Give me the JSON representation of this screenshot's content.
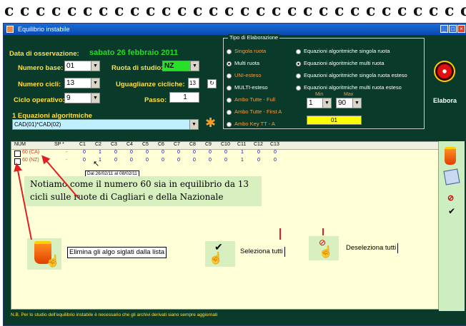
{
  "window": {
    "title": "Equilibrio instabile"
  },
  "labels": {
    "data_osservazione": "Data di osservazione:",
    "data_value": "sabato 26 febbraio 2011",
    "numero_base": "Numero base:",
    "numero_cicli": "Numero cicli:",
    "ciclo_operativo": "Ciclo operativo:",
    "ruota_studio": "Ruota di studio:",
    "uguaglianze": "Uguaglianze cicliche:",
    "passo": "Passo:",
    "equazioni": "1 Equazioni algoritmiche",
    "tipo_elaborazione": "Tipo di Elaborazione",
    "min": "Min",
    "max": "Max",
    "elabora": "Elabora"
  },
  "fields": {
    "numero_base": "01",
    "numero_cicli": "13",
    "ciclo_operativo": "9",
    "ruota": "NZ",
    "uguaglianze": "13",
    "passo": "1",
    "equazione": "CAD(01)*CAD(02)",
    "min": "1",
    "max": "90",
    "yellow_value": "01"
  },
  "radios": [
    {
      "label": "Singola ruota",
      "orange": true,
      "on": false
    },
    {
      "label": "Multi ruota",
      "orange": false,
      "on": true
    },
    {
      "label": "UNI-esteso",
      "orange": true,
      "on": false
    },
    {
      "label": "MULTI-esteso",
      "orange": false,
      "on": false
    },
    {
      "label": "Ambo Tutte - Full",
      "orange": true,
      "on": false
    },
    {
      "label": "Ambo Tutte - First A",
      "orange": true,
      "on": false
    },
    {
      "label": "Ambo Key TT - A",
      "orange": true,
      "on": false
    }
  ],
  "radios_right": [
    {
      "label": "Equazioni algoritmiche singola ruota"
    },
    {
      "label": "Equazioni algoritmiche multi ruota"
    },
    {
      "label": "Equazioni algoritmiche singola ruota esteso"
    },
    {
      "label": "Equazioni algoritmiche multi ruota esteso"
    }
  ],
  "table": {
    "headers": [
      "NUM",
      "SP *",
      "C1",
      "C2",
      "C3",
      "C4",
      "C5",
      "C6",
      "C7",
      "C8",
      "C9",
      "C10",
      "C11",
      "C12",
      "C13"
    ],
    "rows": [
      {
        "num": "60 (CA)",
        "sp": "-",
        "values": [
          "0",
          "1",
          "0",
          "0",
          "0",
          "0",
          "0",
          "0",
          "0",
          "0",
          "1",
          "0",
          "0"
        ]
      },
      {
        "num": "60 (NZ)",
        "sp": "-",
        "values": [
          "0",
          "1",
          "0",
          "0",
          "0",
          "0",
          "0",
          "0",
          "0",
          "0",
          "1",
          "0",
          "0"
        ]
      }
    ],
    "tooltip": "Dal 26/02/11 al 08/02/11"
  },
  "caption": "Notiamo come il numero 60 sia in equilibrio da 13 cicli sulle ruote di Cagliari e della Nazionale",
  "help": {
    "elimina": "Elimina gli algo siglati dalla lista",
    "seleziona": "Seleziona tutti",
    "deseleziona": "Deseleziona tutti"
  },
  "footer": "N.B. Per lo studio dell'equilibrio instabile è necessario che gli archivi derivati siano sempre aggiornati",
  "colors": {
    "accent": "#ffe040",
    "date": "#29d829",
    "background": "#0a3a2a"
  }
}
